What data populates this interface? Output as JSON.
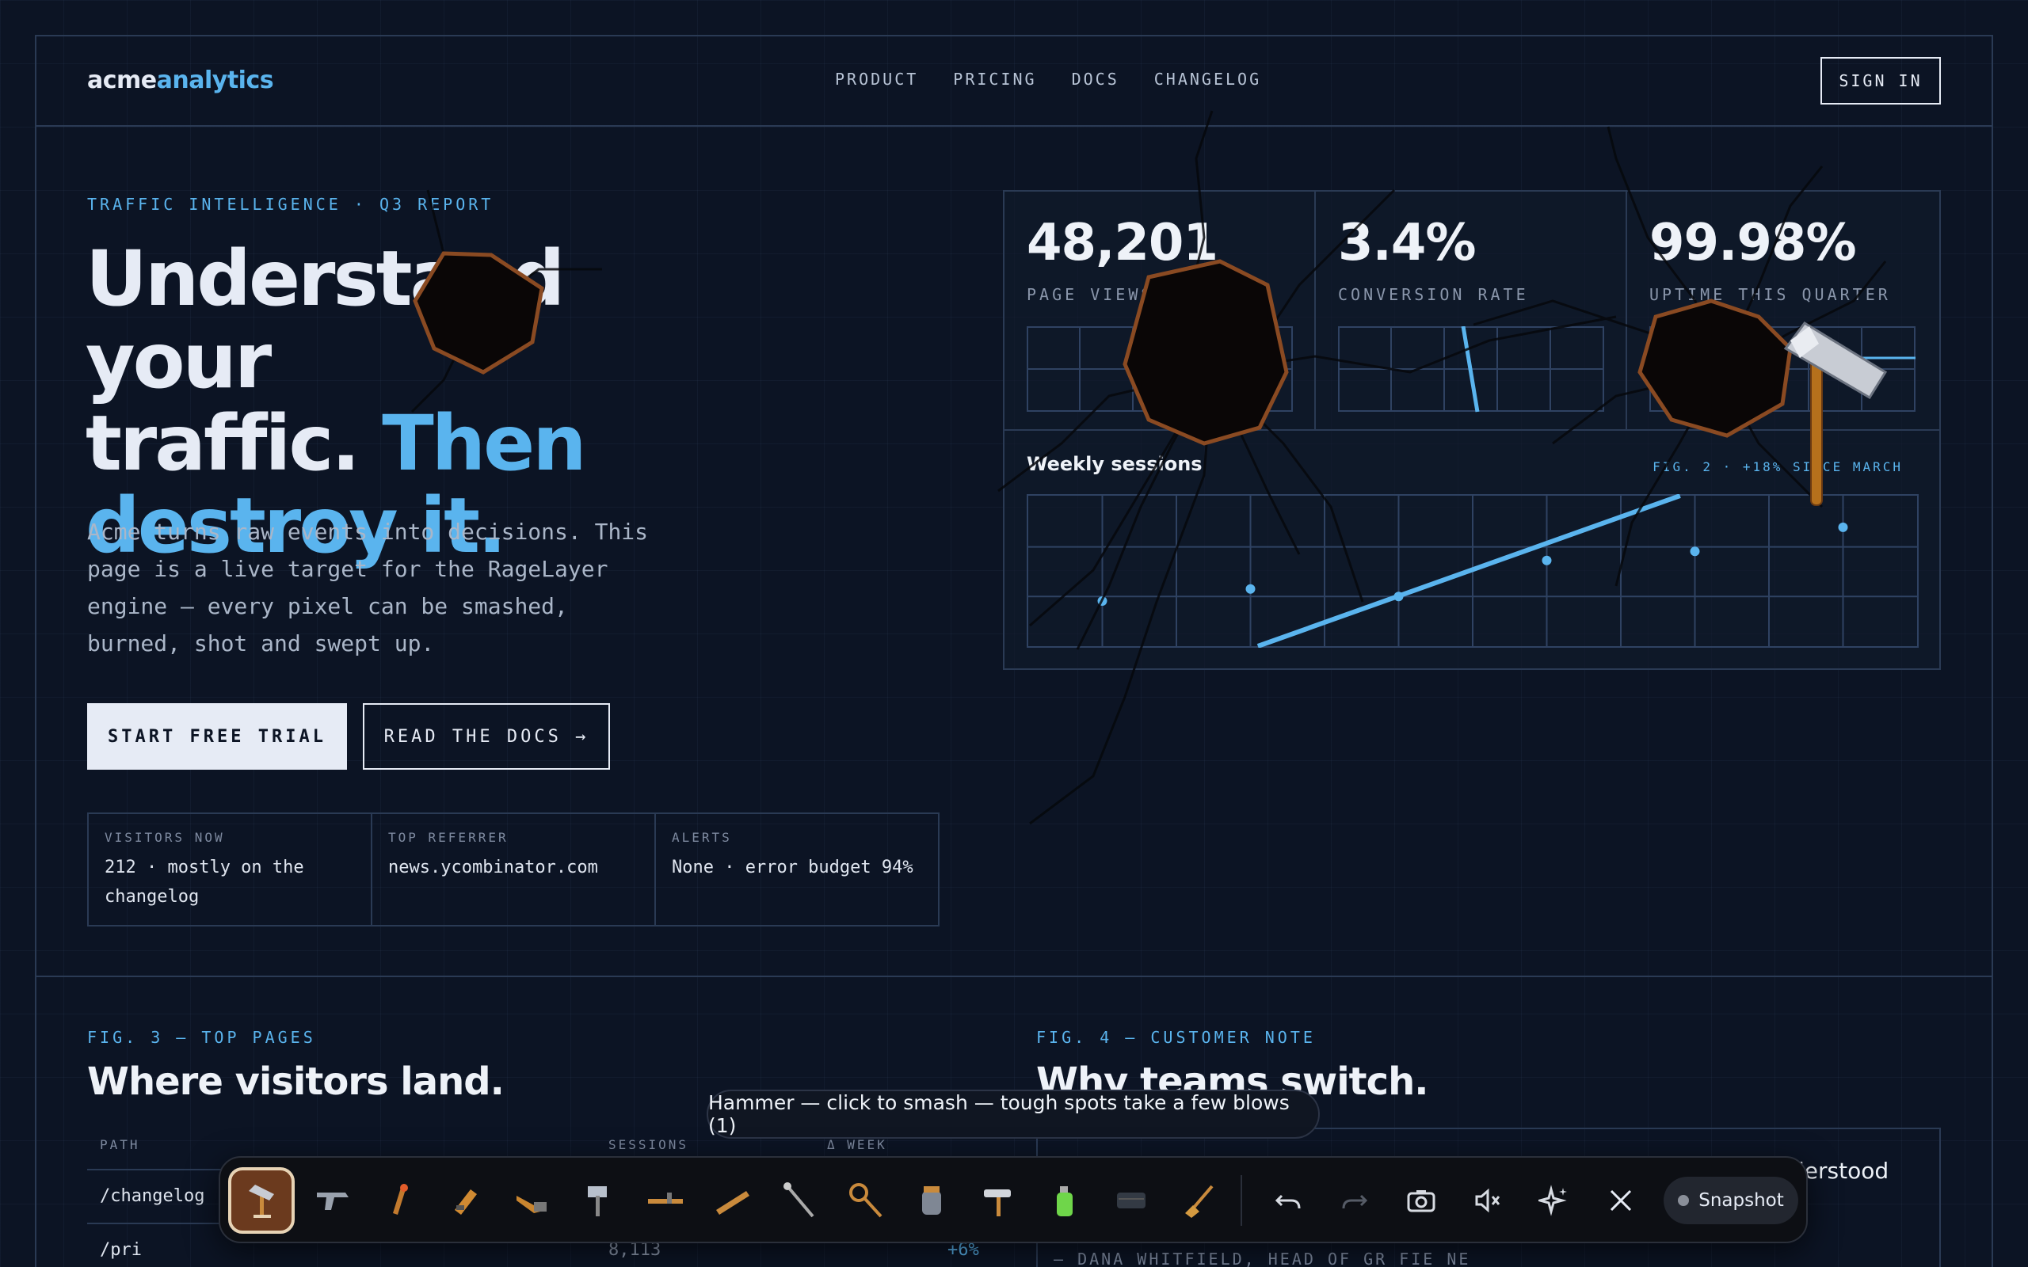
{
  "brand": {
    "part1": "acme",
    "part2": "analytics"
  },
  "nav": [
    "PRODUCT",
    "PRICING",
    "DOCS",
    "CHANGELOG"
  ],
  "signin_label": "SIGN IN",
  "hero": {
    "eyebrow": "TRAFFIC INTELLIGENCE · Q3 REPORT",
    "headline_line1": "Understand your",
    "headline_line2a": "traffic. ",
    "headline_line2b": "Then",
    "headline_line3": "destroy it.",
    "lede": "Acme turns raw events into decisions. This page is a live target for the RageLayer engine — every pixel can be smashed, burned, shot and swept up.",
    "primary_cta": "START FREE TRIAL",
    "secondary_cta": "READ THE DOCS →"
  },
  "stats": [
    {
      "key": "VISITORS NOW",
      "value": "212 · mostly on the changelog"
    },
    {
      "key": "TOP REFERRER",
      "value": "news.ycombinator.com"
    },
    {
      "key": "ALERTS",
      "value": "None · error budget 94%"
    }
  ],
  "metrics": [
    {
      "value": "48,201",
      "label": "PAGE VIEWS · 24H"
    },
    {
      "value": "3.4%",
      "label": "CONVERSION RATE"
    },
    {
      "value": "99.98%",
      "label": "UPTIME THIS QUARTER"
    }
  ],
  "weekly": {
    "title": "Weekly sessions",
    "caption": "FIG. 2 · +18% SINCE MARCH"
  },
  "chart_data": {
    "type": "scatter",
    "title": "Weekly sessions",
    "points": [
      {
        "x": 1,
        "y": 0.3
      },
      {
        "x": 3,
        "y": 0.38
      },
      {
        "x": 5,
        "y": 0.33
      },
      {
        "x": 7,
        "y": 0.57
      },
      {
        "x": 9,
        "y": 0.63
      },
      {
        "x": 11,
        "y": 0.79
      }
    ],
    "trend": {
      "from": [
        3.1,
        0.0
      ],
      "to": [
        8.8,
        1.0
      ]
    },
    "xlim": [
      0,
      12
    ],
    "ylim": [
      0,
      1
    ],
    "grid": true
  },
  "top_pages": {
    "eyebrow": "FIG. 3 — TOP PAGES",
    "title": "Where visitors land.",
    "columns": [
      "PATH",
      "SESSIONS",
      "Δ WEEK"
    ],
    "rows": [
      {
        "path": "/changelog",
        "sessions": "",
        "delta": ""
      },
      {
        "path": "/pri",
        "sessions": "8,113",
        "delta": "+6%"
      }
    ]
  },
  "customer_note": {
    "eyebrow": "FIG. 4 — CUSTOMER NOTE",
    "title": "Why teams switch.",
    "quote_fragment": "lerstood",
    "attribution": "— DANA WHITFIELD, HEAD OF GR    FIE    NE"
  },
  "toast": "Hammer — click to smash — tough spots take a few blows (1)",
  "toolbar": {
    "tools": [
      "hammer",
      "gun",
      "flamethrower",
      "pistol",
      "chainsaw",
      "sledgehammer",
      "rifle",
      "bat",
      "axe",
      "lasso",
      "jar",
      "roller",
      "spray",
      "tape",
      "broom"
    ],
    "snapshot_label": "Snapshot"
  },
  "colors": {
    "accent": "#5ab4ee",
    "background": "#0c1424",
    "border": "#2a3a54"
  }
}
